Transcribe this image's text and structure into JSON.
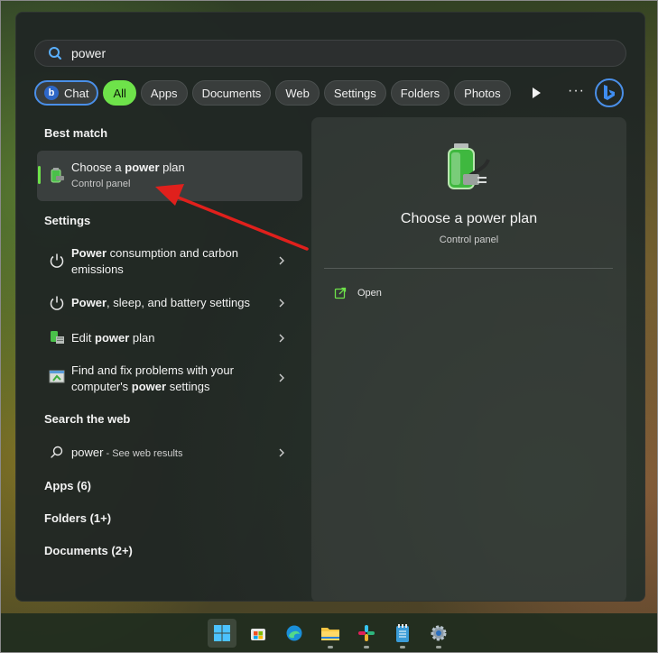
{
  "search": {
    "value": "power"
  },
  "filters": [
    "Chat",
    "All",
    "Apps",
    "Documents",
    "Web",
    "Settings",
    "Folders",
    "Photos"
  ],
  "best_match": {
    "header": "Best match",
    "title_pre": "Choose a ",
    "title_bold": "power",
    "title_post": " plan",
    "subtitle": "Control panel"
  },
  "settings": {
    "header": "Settings",
    "items": [
      {
        "bold": "Power",
        "text1": " consumption and carbon",
        "text2": "emissions"
      },
      {
        "bold": "Power",
        "text1": ", sleep, and battery settings"
      },
      {
        "pre": "Edit ",
        "bold": "power",
        "text1": " plan"
      },
      {
        "text1": "Find and fix problems with your",
        "pre2": "computer's ",
        "bold": "power",
        "text2": " settings"
      }
    ]
  },
  "web": {
    "header": "Search the web",
    "query": "power",
    "suffix": " - See web results"
  },
  "groups": {
    "apps": "Apps (6)",
    "folders": "Folders (1+)",
    "documents": "Documents (2+)"
  },
  "detail": {
    "title": "Choose a power plan",
    "subtitle": "Control panel",
    "action": "Open"
  },
  "colors": {
    "accent_green": "#6ee24a",
    "chat_blue": "#4a8fe8",
    "annotation_red": "#e0201c"
  },
  "taskbar_icons": [
    "windows-start-icon",
    "store-icon",
    "edge-icon",
    "file-explorer-icon",
    "slack-icon",
    "notepad-icon",
    "settings-gear-icon"
  ]
}
